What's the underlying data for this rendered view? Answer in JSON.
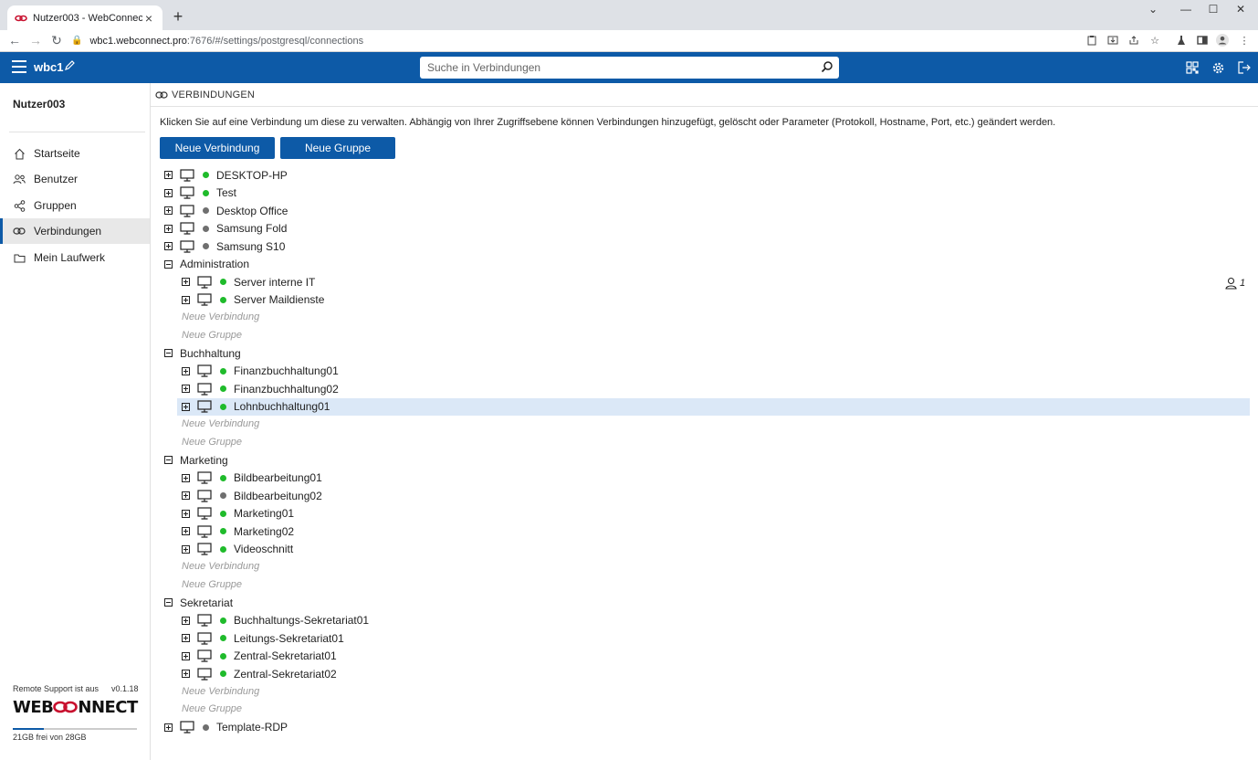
{
  "browser": {
    "tab_title": "Nutzer003 - WebConnect",
    "url_host": "wbc1.webconnect.pro",
    "url_path": ":7676/#/settings/postgresql/connections"
  },
  "header": {
    "app_name": "wbc1",
    "search_placeholder": "Suche in Verbindungen"
  },
  "sidebar": {
    "username": "Nutzer003",
    "items": [
      {
        "label": "Startseite"
      },
      {
        "label": "Benutzer"
      },
      {
        "label": "Gruppen"
      },
      {
        "label": "Verbindungen"
      },
      {
        "label": "Mein Laufwerk"
      }
    ],
    "remote_support": "Remote Support ist aus",
    "version": "v0.1.18",
    "logo_pre": "WEB",
    "logo_post": "NNECT",
    "quota_text": "21GB frei von 28GB",
    "quota_used_fraction": 0.25
  },
  "main": {
    "breadcrumb": "VERBINDUNGEN",
    "intro": "Klicken Sie auf eine Verbindung um diese zu verwalten. Abhängig von Ihrer Zugriffsebene können Verbindungen hinzugefügt, gelöscht oder Parameter (Protokoll, Hostname, Port, etc.) geändert werden.",
    "btn_new_connection": "Neue Verbindung",
    "btn_new_group": "Neue Gruppe",
    "placeholder_new_connection": "Neue Verbindung",
    "placeholder_new_group": "Neue Gruppe",
    "active_user_count": "1"
  },
  "tree": {
    "top": [
      {
        "name": "DESKTOP-HP",
        "online": true
      },
      {
        "name": "Test",
        "online": true
      },
      {
        "name": "Desktop Office",
        "online": false
      },
      {
        "name": "Samsung Fold",
        "online": false
      },
      {
        "name": "Samsung S10",
        "online": false
      }
    ],
    "groups": [
      {
        "name": "Administration",
        "items": [
          {
            "name": "Server interne IT",
            "online": true
          },
          {
            "name": "Server Maildienste",
            "online": true
          }
        ]
      },
      {
        "name": "Buchhaltung",
        "items": [
          {
            "name": "Finanzbuchhaltung01",
            "online": true
          },
          {
            "name": "Finanzbuchhaltung02",
            "online": true
          },
          {
            "name": "Lohnbuchhaltung01",
            "online": true,
            "selected": true
          }
        ]
      },
      {
        "name": "Marketing",
        "items": [
          {
            "name": "Bildbearbeitung01",
            "online": true
          },
          {
            "name": "Bildbearbeitung02",
            "online": false
          },
          {
            "name": "Marketing01",
            "online": true
          },
          {
            "name": "Marketing02",
            "online": true
          },
          {
            "name": "Videoschnitt",
            "online": true
          }
        ]
      },
      {
        "name": "Sekretariat",
        "items": [
          {
            "name": "Buchhaltungs-Sekretariat01",
            "online": true
          },
          {
            "name": "Leitungs-Sekretariat01",
            "online": true
          },
          {
            "name": "Zentral-Sekretariat01",
            "online": true
          },
          {
            "name": "Zentral-Sekretariat02",
            "online": true
          }
        ]
      }
    ],
    "bottom": [
      {
        "name": "Template-RDP",
        "online": false
      }
    ]
  },
  "colors": {
    "brand": "#0d5aa7",
    "online": "#1fbb2b",
    "offline": "#6f6f6f",
    "selected_row": "#dbe8f7",
    "logo_accent": "#c8102e"
  }
}
